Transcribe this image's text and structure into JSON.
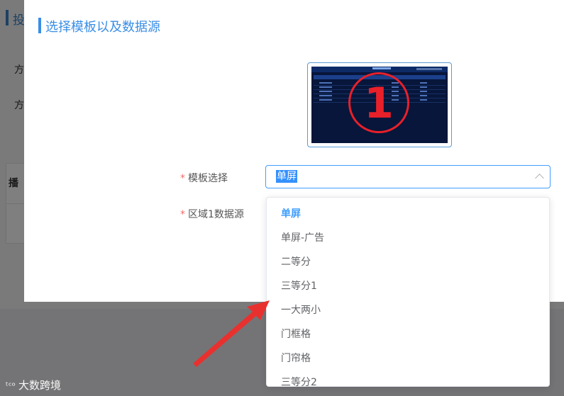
{
  "background": {
    "title_fragment": "投",
    "label1_fragment": "方",
    "label2_fragment": "方",
    "table_header_fragment": "播"
  },
  "dialog": {
    "title": "选择模板以及数据源",
    "preview": {
      "number": "1"
    },
    "template_label": "模板选择",
    "region_label": "区域1数据源",
    "required_mark": "*",
    "template_select": {
      "value": "单屏"
    }
  },
  "dropdown": {
    "options": [
      {
        "label": "单屏",
        "selected": true
      },
      {
        "label": "单屏-广告",
        "selected": false
      },
      {
        "label": "二等分",
        "selected": false
      },
      {
        "label": "三等分1",
        "selected": false
      },
      {
        "label": "一大两小",
        "selected": false
      },
      {
        "label": "门框格",
        "selected": false
      },
      {
        "label": "门帘格",
        "selected": false
      },
      {
        "label": "三等分2",
        "selected": false
      }
    ]
  },
  "watermark": {
    "logo": "ᵗᶜᵒ",
    "text": "大数跨境"
  },
  "colors": {
    "accent": "#409eff",
    "required": "#f56c6c",
    "annotation_arrow": "#e8312f"
  }
}
